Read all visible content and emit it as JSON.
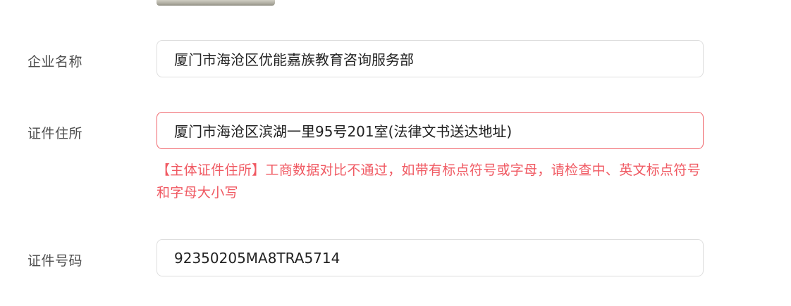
{
  "form": {
    "company_name": {
      "label": "企业名称",
      "value": "厦门市海沧区优能嘉族教育咨询服务部"
    },
    "certificate_address": {
      "label": "证件住所",
      "value": "厦门市海沧区滨湖一里95号201室(法律文书送达地址)",
      "error": "【主体证件住所】工商数据对比不通过，如带有标点符号或字母，请检查中、英文标点符号和字母大小写"
    },
    "certificate_number": {
      "label": "证件号码",
      "value": "92350205MA8TRA5714"
    }
  },
  "colors": {
    "error": "#f05a63",
    "error_border": "#f0666c",
    "input_border": "#dedede",
    "label": "#4d4d4d"
  }
}
